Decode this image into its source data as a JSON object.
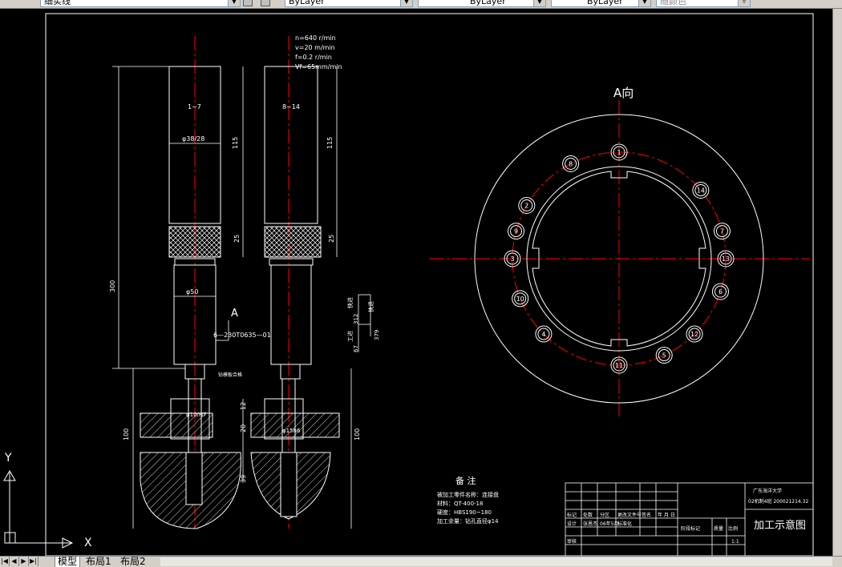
{
  "toolbar": {
    "layer_name": "细实线",
    "color_value": "ByLayer",
    "linetype_value": "ByLayer",
    "lineweight_value": "ByLayer",
    "plotstyle_value": "随颜色"
  },
  "drawing": {
    "params": [
      "n=640 r/min",
      "v=20 m/min",
      "f=0.2 r/min",
      "Vf=65mm/min"
    ],
    "tool_label_1": "1~7",
    "tool_label_2": "8~14",
    "dim_dia_38": "φ38/28",
    "dim_dia_50": "φ50",
    "dim_115_a": "115",
    "dim_115_b": "115",
    "dim_25_a": "25",
    "dim_25_b": "25",
    "dim_300": "300",
    "dim_100_a": "100",
    "dim_100_b": "100",
    "dim_12": "12",
    "dim_20": "20",
    "dim_39": "39",
    "view_arrow_label": "A",
    "part_code": "6—230T0635—01",
    "drill_note": "钻模板合格",
    "dim_hole_a": "φ10/H7",
    "dim_hole_b": "φ15h6",
    "feed_labels": [
      "快进",
      "312",
      "工进",
      "67",
      "快退",
      "379"
    ],
    "view_title": "A向",
    "holes": [
      {
        "label": "1",
        "deg": -90
      },
      {
        "label": "8",
        "deg": -117
      },
      {
        "label": "14",
        "deg": -40
      },
      {
        "label": "2",
        "deg": -150
      },
      {
        "label": "7",
        "deg": -15
      },
      {
        "label": "9",
        "deg": -165
      },
      {
        "label": "13",
        "deg": 0
      },
      {
        "label": "3",
        "deg": 180
      },
      {
        "label": "6",
        "deg": 18
      },
      {
        "label": "10",
        "deg": 158
      },
      {
        "label": "12",
        "deg": 45
      },
      {
        "label": "4",
        "deg": 135
      },
      {
        "label": "5",
        "deg": 65
      },
      {
        "label": "11",
        "deg": 90
      }
    ],
    "notes": {
      "title": "备 注",
      "lines": [
        "被加工零件名称：连接盘",
        "材料：QT-400-18",
        "硬度：HBS190~180",
        "加工余量：钻孔直径φ14"
      ]
    }
  },
  "title_block": {
    "school": "广东海洋大学",
    "class_id": "02机制4班 200021214.32",
    "drawing_name": "加工示意图",
    "scale": "1:1",
    "cells": [
      "标记",
      "处数",
      "分区",
      "更改文件号",
      "签名",
      "年 月 日",
      "设计",
      "张恩杰",
      "06年5月",
      "标准化",
      "阶段标记",
      "质量",
      "比例",
      "审核"
    ]
  },
  "ucs": {
    "x_label": "X",
    "y_label": "Y"
  },
  "tabs": [
    {
      "label": "模型",
      "active": true
    },
    {
      "label": "布局1",
      "active": false
    },
    {
      "label": "布局2",
      "active": false
    }
  ]
}
